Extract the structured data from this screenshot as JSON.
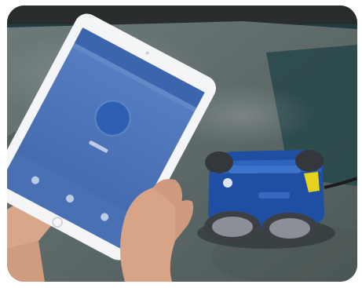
{
  "scene": {
    "subject": "pool-robot-tablet",
    "device": {
      "type": "tablet",
      "screen_color": "#4a72b8",
      "header_color": "#3d65ad",
      "button_color": "#2f5fb0",
      "frame_color": "#f4f5f7"
    },
    "robot": {
      "body_color": "#1f4fa3",
      "accent_color": "#e6d21a",
      "wheel_color": "#3c3f44"
    },
    "water_color": "#2b4a4f",
    "stone_color": "#5b6a69"
  }
}
